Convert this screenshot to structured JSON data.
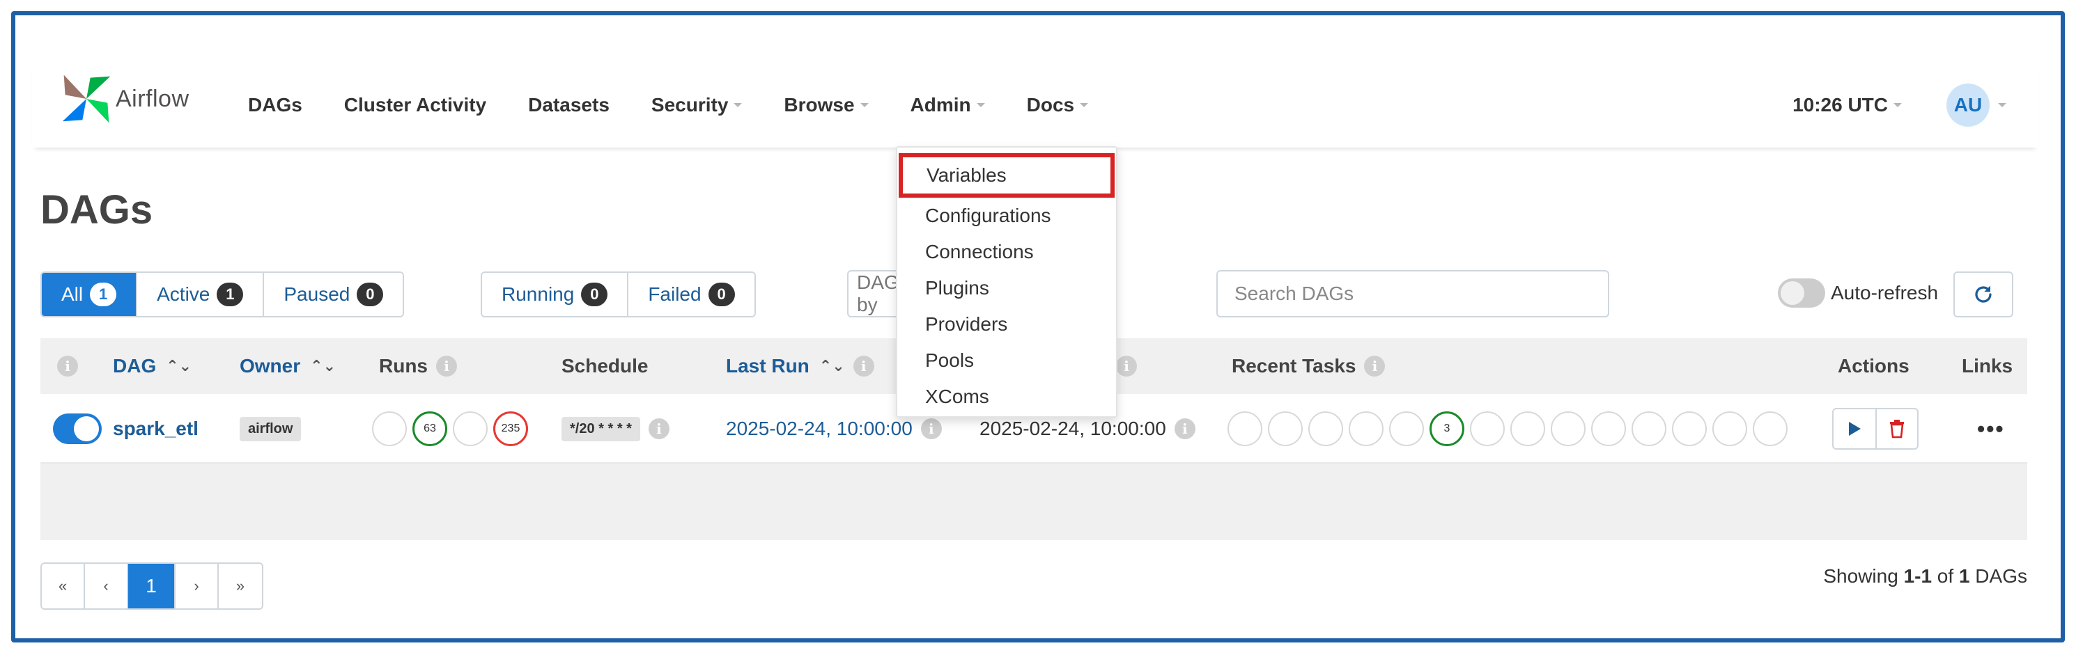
{
  "brand": {
    "name": "Airflow"
  },
  "nav": {
    "items": [
      {
        "label": "DAGs",
        "caret": false
      },
      {
        "label": "Cluster Activity",
        "caret": false
      },
      {
        "label": "Datasets",
        "caret": false
      },
      {
        "label": "Security",
        "caret": true
      },
      {
        "label": "Browse",
        "caret": true
      },
      {
        "label": "Admin",
        "caret": true
      },
      {
        "label": "Docs",
        "caret": true
      }
    ],
    "time": "10:26 UTC",
    "user_initials": "AU"
  },
  "page": {
    "title": "DAGs"
  },
  "filters": {
    "status": [
      {
        "label": "All",
        "count": "1"
      },
      {
        "label": "Active",
        "count": "1"
      },
      {
        "label": "Paused",
        "count": "0"
      }
    ],
    "runs": [
      {
        "label": "Running",
        "count": "0"
      },
      {
        "label": "Failed",
        "count": "0"
      }
    ],
    "tag_placeholder": "Filter DAGs by tag",
    "search_placeholder": "Search DAGs",
    "auto_refresh_label": "Auto-refresh"
  },
  "table": {
    "headers": {
      "dag": "DAG",
      "owner": "Owner",
      "runs": "Runs",
      "schedule": "Schedule",
      "last_run": "Last Run",
      "recent_tasks": "Recent Tasks",
      "actions": "Actions",
      "links": "Links"
    },
    "rows": [
      {
        "dag_id": "spark_etl",
        "owner": "airflow",
        "runs": [
          "",
          "63",
          "",
          "235"
        ],
        "schedule": "*/20 * * * *",
        "last_run": "2025-02-24, 10:00:00",
        "next_run": "2025-02-24, 10:00:00",
        "recent_task_counts": [
          "",
          "",
          "",
          "",
          "",
          "3",
          "",
          "",
          "",
          "",
          "",
          "",
          "",
          "",
          ""
        ]
      }
    ]
  },
  "pagination": {
    "first": "«",
    "prev": "‹",
    "current": "1",
    "next": "›",
    "last": "»",
    "showing_prefix": "Showing ",
    "showing_range": "1-1",
    "showing_of": " of ",
    "showing_total": "1",
    "showing_suffix": " DAGs"
  },
  "admin_menu": {
    "items": [
      "Variables",
      "Configurations",
      "Connections",
      "Plugins",
      "Providers",
      "Pools",
      "XComs"
    ],
    "highlighted": "Variables"
  },
  "colors": {
    "frame_border": "#1f5fa6",
    "primary": "#1c7cd6",
    "success": "#1a8a2a",
    "failed": "#e53935",
    "highlight_box": "#d72323"
  }
}
